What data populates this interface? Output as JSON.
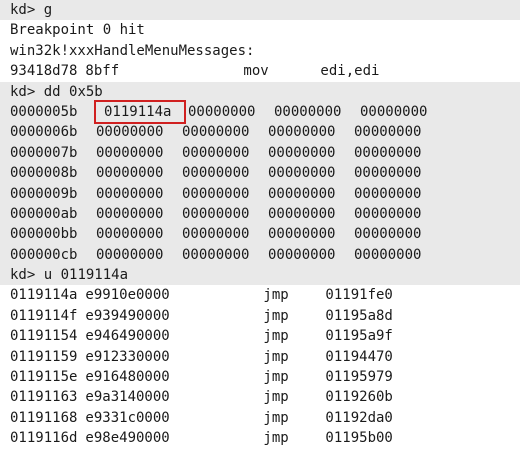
{
  "session": {
    "cmd_g": {
      "prompt": "kd>",
      "command": "g"
    },
    "breakpoint_msg": "Breakpoint 0 hit",
    "symbol": "win32k!xxxHandleMenuMessages:",
    "first_instr": {
      "addr": "93418d78",
      "bytes": "8bff",
      "mnemonic": "mov",
      "operands": "edi,edi"
    },
    "cmd_dd": {
      "prompt": "kd>",
      "command": "dd 0x5b"
    },
    "dd_rows": [
      {
        "addr": "0000005b",
        "values": [
          "0119114a",
          "00000000",
          "00000000",
          "00000000"
        ]
      },
      {
        "addr": "0000006b",
        "values": [
          "00000000",
          "00000000",
          "00000000",
          "00000000"
        ]
      },
      {
        "addr": "0000007b",
        "values": [
          "00000000",
          "00000000",
          "00000000",
          "00000000"
        ]
      },
      {
        "addr": "0000008b",
        "values": [
          "00000000",
          "00000000",
          "00000000",
          "00000000"
        ]
      },
      {
        "addr": "0000009b",
        "values": [
          "00000000",
          "00000000",
          "00000000",
          "00000000"
        ]
      },
      {
        "addr": "000000ab",
        "values": [
          "00000000",
          "00000000",
          "00000000",
          "00000000"
        ]
      },
      {
        "addr": "000000bb",
        "values": [
          "00000000",
          "00000000",
          "00000000",
          "00000000"
        ]
      },
      {
        "addr": "000000cb",
        "values": [
          "00000000",
          "00000000",
          "00000000",
          "00000000"
        ]
      }
    ],
    "highlight_color": "#d02020",
    "cmd_u": {
      "prompt": "kd>",
      "command": "u 0119114a"
    },
    "disasm_rows": [
      {
        "addr": "0119114a",
        "bytes": "e9910e0000",
        "mnemonic": "jmp",
        "operands": "01191fe0"
      },
      {
        "addr": "0119114f",
        "bytes": "e939490000",
        "mnemonic": "jmp",
        "operands": "01195a8d"
      },
      {
        "addr": "01191154",
        "bytes": "e946490000",
        "mnemonic": "jmp",
        "operands": "01195a9f"
      },
      {
        "addr": "01191159",
        "bytes": "e912330000",
        "mnemonic": "jmp",
        "operands": "01194470"
      },
      {
        "addr": "0119115e",
        "bytes": "e916480000",
        "mnemonic": "jmp",
        "operands": "01195979"
      },
      {
        "addr": "01191163",
        "bytes": "e9a3140000",
        "mnemonic": "jmp",
        "operands": "0119260b"
      },
      {
        "addr": "01191168",
        "bytes": "e9331c0000",
        "mnemonic": "jmp",
        "operands": "01192da0"
      },
      {
        "addr": "0119116d",
        "bytes": "e98e490000",
        "mnemonic": "jmp",
        "operands": "01195b00"
      }
    ]
  }
}
